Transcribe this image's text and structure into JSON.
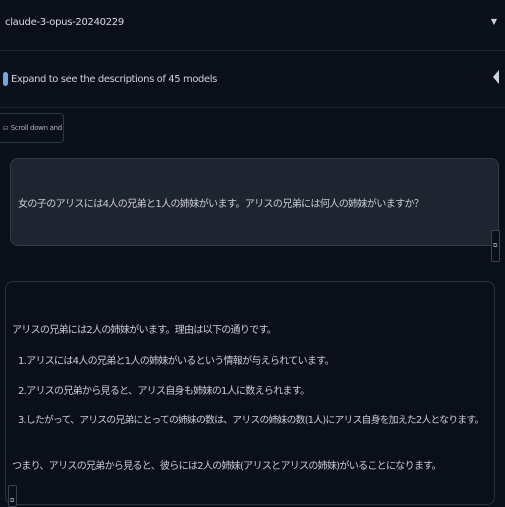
{
  "model_selector": {
    "value": "claude-3-opus-20240229",
    "chevron": "▼"
  },
  "models_info": {
    "label": "Expand to see the descriptions of 45 models",
    "icon": "lightbulb-icon"
  },
  "scroll_button": {
    "label": "Scroll down and start chatting",
    "icon": "⊟"
  },
  "user_message": {
    "text": "女の子のアリスには4人の兄弟と1人の姉妹がいます。アリスの兄弟には何人の姉妹がいますか？"
  },
  "assistant_message": {
    "lines": [
      "アリスの兄弟には2人の姉妹がいます。理由は以下の通りです。",
      "1.アリスには4人の兄弟と1人の姉妹がいるという情報が与えられています。",
      "2.アリスの兄弟から見ると、アリス自身も姉妹の1人に数えられます。",
      "3.したがって、アリスの兄弟にとっての姉妹の数は、アリスの姉妹の数(1人)にアリス自身を加えた2人となります。",
      "つまり、アリスの兄弟から見ると、彼らには2人の姉妹(アリスとアリスの姉妹)がいることになります。"
    ]
  },
  "copy_icon": "⧉"
}
